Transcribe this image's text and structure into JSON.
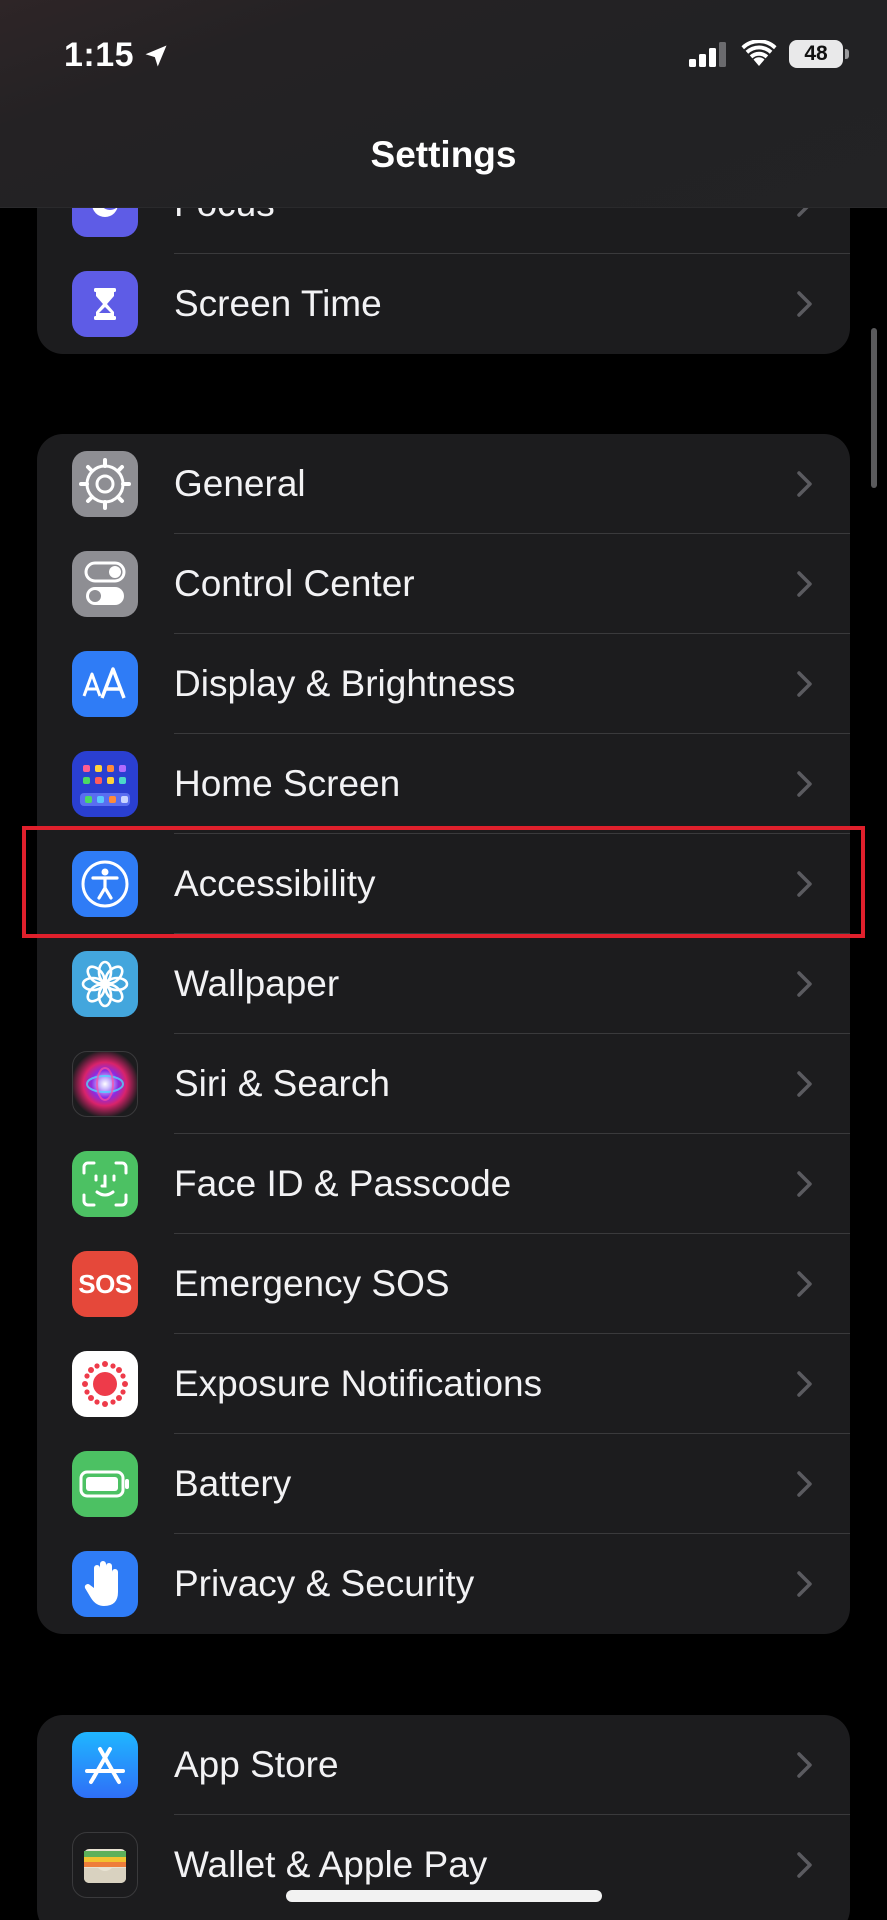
{
  "status_bar": {
    "time": "1:15",
    "battery": "48"
  },
  "nav": {
    "title": "Settings"
  },
  "group1": [
    {
      "label": "Focus",
      "icon": "focus-icon",
      "color": "#5e5ce6"
    },
    {
      "label": "Screen Time",
      "icon": "hourglass-icon",
      "color": "#5e5ce6"
    }
  ],
  "group2": [
    {
      "label": "General",
      "icon": "gear-icon",
      "color": "#8e8e93"
    },
    {
      "label": "Control Center",
      "icon": "toggles-icon",
      "color": "#8e8e93"
    },
    {
      "label": "Display & Brightness",
      "icon": "text-size-icon",
      "color": "#2f7cf6"
    },
    {
      "label": "Home Screen",
      "icon": "app-grid-icon",
      "color": "#2a3fd1"
    },
    {
      "label": "Accessibility",
      "icon": "accessibility-icon",
      "color": "#2f7cf6"
    },
    {
      "label": "Wallpaper",
      "icon": "flower-icon",
      "color": "#43a6dd"
    },
    {
      "label": "Siri & Search",
      "icon": "siri-icon",
      "color": "#1c1c1e"
    },
    {
      "label": "Face ID & Passcode",
      "icon": "face-id-icon",
      "color": "#4cc163"
    },
    {
      "label": "Emergency SOS",
      "icon": "sos-icon",
      "color": "#e5483a",
      "icon_text": "SOS"
    },
    {
      "label": "Exposure Notifications",
      "icon": "exposure-icon",
      "color": "#ffffff"
    },
    {
      "label": "Battery",
      "icon": "battery-icon",
      "color": "#4cc163"
    },
    {
      "label": "Privacy & Security",
      "icon": "hand-icon",
      "color": "#2f7cf6"
    }
  ],
  "group3": [
    {
      "label": "App Store",
      "icon": "app-store-icon",
      "color": "#2f8ff7"
    },
    {
      "label": "Wallet & Apple Pay",
      "icon": "wallet-icon",
      "color": "#1c1c1e"
    }
  ],
  "highlight_color": "#e0202c"
}
